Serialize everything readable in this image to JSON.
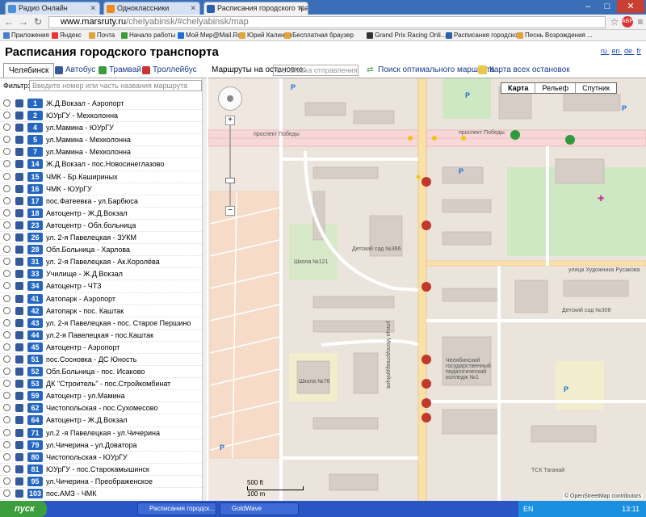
{
  "browser": {
    "tabs": [
      {
        "label": "Радио Онлайн",
        "color": "#4a8fd8"
      },
      {
        "label": "Одноклассники",
        "color": "#f08a1c"
      },
      {
        "label": "Расписания городского тра",
        "color": "#2a5fb0"
      }
    ],
    "url_domain": "www.marsruty.ru",
    "url_path": "/chelyabinsk/#chelyabinsk/map",
    "bookmarks": [
      "Приложения",
      "Яндекс",
      "Почта",
      "Начало работы",
      "Мой Мир@Mail.Ru",
      "Юрий Калинин",
      "Бесплатная браузер",
      "Grand Prix Racing Onli...",
      "Расписания городско...",
      "Песнь Возрождения ..."
    ]
  },
  "site": {
    "title": "Расписания городского транспорта",
    "languages": [
      "ru",
      "en",
      "de",
      "fr"
    ]
  },
  "transport_tabs": {
    "city": "Челябинск",
    "bus": "Автобус",
    "tram": "Трамвай",
    "trolley": "Троллейбус",
    "stop_label": "Маршруты на остановке:",
    "stop_placeholder": "Остановка отправления",
    "route_search": "Поиск оптимального маршрута",
    "all_stops": "Карта всех остановок"
  },
  "filter": {
    "label": "Фильтр:",
    "placeholder": "Введите номер или часть названия маршрута"
  },
  "routes": [
    {
      "num": "1",
      "name": "Ж.Д.Вокзал - Аэропорт"
    },
    {
      "num": "2",
      "name": "ЮУрГУ - Мехколонна"
    },
    {
      "num": "4",
      "name": "ул.Мамина - ЮУрГУ"
    },
    {
      "num": "5",
      "name": "ул.Мамина - Мехколонна"
    },
    {
      "num": "7",
      "name": "ул.Мамина - Мехколонна"
    },
    {
      "num": "14",
      "name": "Ж.Д.Вокзал - пос.Новосинеглазово"
    },
    {
      "num": "15",
      "name": "ЧМК - Бр.Кашириных"
    },
    {
      "num": "16",
      "name": "ЧМК - ЮУрГУ"
    },
    {
      "num": "17",
      "name": "пос.Фатеевка - ул.Барбюса"
    },
    {
      "num": "18",
      "name": "Автоцентр - Ж.Д.Вокзал"
    },
    {
      "num": "23",
      "name": "Автоцентр - Обл.больница"
    },
    {
      "num": "26",
      "name": "ул. 2-я Павелецкая - ЗУКМ"
    },
    {
      "num": "28",
      "name": "Обл.Больница - Харлова"
    },
    {
      "num": "31",
      "name": "ул. 2-я Павелецкая - Ак.Королёва"
    },
    {
      "num": "33",
      "name": "Училище - Ж.Д.Вокзал"
    },
    {
      "num": "34",
      "name": "Автоцентр - ЧТЗ"
    },
    {
      "num": "41",
      "name": "Автопарк - Аэропорт"
    },
    {
      "num": "42",
      "name": "Автопарк - пос. Каштак"
    },
    {
      "num": "43",
      "name": "ул. 2-я Павелецкая - пос. Старое Першино"
    },
    {
      "num": "44",
      "name": "ул.2-я Павелецкая - пос.Каштак"
    },
    {
      "num": "45",
      "name": "Автоцентр - Аэропорт"
    },
    {
      "num": "51",
      "name": "пос.Сосновка - ДС Юность"
    },
    {
      "num": "52",
      "name": "Обл.Больница - пос. Исаково"
    },
    {
      "num": "53",
      "name": "ДК \"Строитель\" - пос.Стройкомбинат"
    },
    {
      "num": "59",
      "name": "Автоцентр - ул.Мамина"
    },
    {
      "num": "62",
      "name": "Чистопольская - пос.Сухомесово"
    },
    {
      "num": "64",
      "name": "Автоцентр - Ж.Д.Вокзал"
    },
    {
      "num": "71",
      "name": "ул.2 -я Павелецкая - ул.Чичерина"
    },
    {
      "num": "79",
      "name": "ул.Чичерина - ул.Доватора"
    },
    {
      "num": "80",
      "name": "Чистопольская - ЮУрГУ"
    },
    {
      "num": "81",
      "name": "ЮУрГУ - пос.Старокамышинск"
    },
    {
      "num": "95",
      "name": "ул.Чичерина - Преображенское"
    },
    {
      "num": "103",
      "name": "пос.АМЗ - ЧМК"
    }
  ],
  "map": {
    "type_buttons": [
      "Карта",
      "Рельеф",
      "Спутник"
    ],
    "street_labels": [
      "проспект Победы",
      "проспект Победы",
      "улица Художника Русакова",
      "улица Молодогвардейцев"
    ],
    "place_labels": [
      "Школа №121",
      "Детский сад №366",
      "Школа №78",
      "Детский сад №308",
      "Челябинский государственный педагогический колледж №1",
      "ТСК Таганай"
    ],
    "scale_ft": "500 ft",
    "scale_m": "100 m",
    "attribution": "© OpenStreetMap contributors"
  },
  "taskbar": {
    "start": "пуск",
    "tasks": [
      "Расписания городск...",
      "GoldWave"
    ],
    "lang": "EN",
    "clock": "13:11"
  }
}
